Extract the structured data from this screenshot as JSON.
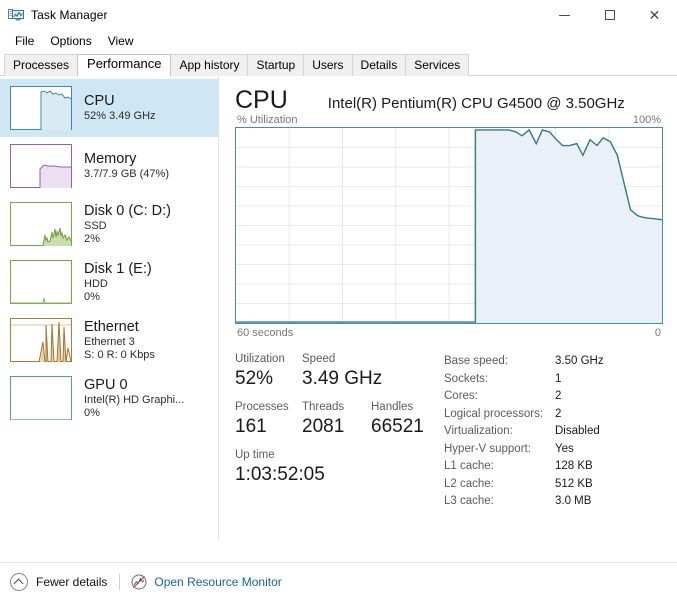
{
  "window": {
    "title": "Task Manager",
    "icon": "task-manager-icon",
    "controls": {
      "minimize": "—",
      "maximize": "□",
      "close": "✕"
    }
  },
  "menu": {
    "items": [
      {
        "label": "File"
      },
      {
        "label": "Options"
      },
      {
        "label": "View"
      }
    ]
  },
  "tabs": {
    "active": "Performance",
    "items": [
      {
        "label": "Processes"
      },
      {
        "label": "Performance"
      },
      {
        "label": "App history"
      },
      {
        "label": "Startup"
      },
      {
        "label": "Users"
      },
      {
        "label": "Details"
      },
      {
        "label": "Services"
      }
    ]
  },
  "sidebar": {
    "items": [
      {
        "name": "cpu",
        "title": "CPU",
        "sub1": "52%  3.49 GHz",
        "sub2": "",
        "selected": true,
        "color": "#3b8ba8",
        "fill": "#daeaf3"
      },
      {
        "name": "memory",
        "title": "Memory",
        "sub1": "3.7/7.9 GB (47%)",
        "sub2": "",
        "selected": false,
        "color": "#9b5fa8",
        "fill": "#ecdff0"
      },
      {
        "name": "disk-0",
        "title": "Disk 0 (C: D:)",
        "sub1": "SSD",
        "sub2": "2%",
        "selected": false,
        "color": "#7ba44a",
        "fill": "#e3eed5"
      },
      {
        "name": "disk-1",
        "title": "Disk 1 (E:)",
        "sub1": "HDD",
        "sub2": "0%",
        "selected": false,
        "color": "#7ba44a",
        "fill": "#e3eed5"
      },
      {
        "name": "ethernet",
        "title": "Ethernet",
        "sub1": "Ethernet 3",
        "sub2": "S: 0 R: 0 Kbps",
        "selected": false,
        "color": "#b07b3c",
        "fill": "#f0e2cc"
      },
      {
        "name": "gpu-0",
        "title": "GPU 0",
        "sub1": "Intel(R) HD Graphi...",
        "sub2": "0%",
        "selected": false,
        "color": "#5d95b5",
        "fill": "#dfeaf2"
      }
    ]
  },
  "main": {
    "title": "CPU",
    "model": "Intel(R) Pentium(R) CPU G4500 @ 3.50GHz",
    "graph_axis_top_left": "% Utilization",
    "graph_axis_top_right": "100%",
    "graph_axis_bottom_left": "60 seconds",
    "graph_axis_bottom_right": "0",
    "graph_line_color": "#35788c",
    "graph_fill_color": "#e9f0f7",
    "graph_border_color": "#4a8ca5"
  },
  "chart_data": {
    "type": "area",
    "title": "% Utilization",
    "xlabel": "60 seconds",
    "ylabel": "% Utilization",
    "ylim": [
      0,
      100
    ],
    "xlim": [
      60,
      0
    ],
    "grid": true,
    "legend": "none",
    "series": [
      {
        "name": "CPU Utilization",
        "values": [
          0,
          0,
          0,
          0,
          0,
          0,
          0,
          0,
          0,
          0,
          0,
          0,
          0,
          0,
          0,
          0,
          0,
          0,
          0,
          0,
          0,
          0,
          0,
          0,
          0,
          0,
          0,
          0,
          0,
          0,
          0,
          0,
          0,
          0,
          0,
          0,
          99,
          99,
          99,
          99,
          99,
          99,
          99,
          98,
          96,
          99,
          92,
          99,
          98,
          94,
          91,
          91,
          92,
          86,
          94,
          91,
          95,
          93,
          86,
          73,
          58,
          55,
          54
        ]
      }
    ]
  },
  "stats": {
    "rows": [
      [
        {
          "label": "Utilization",
          "value": "52%"
        },
        {
          "label": "Speed",
          "value": "3.49 GHz"
        }
      ],
      [
        {
          "label": "Processes",
          "value": "161"
        },
        {
          "label": "Threads",
          "value": "2081"
        },
        {
          "label": "Handles",
          "value": "66521"
        }
      ],
      [
        {
          "label": "Up time",
          "value": "1:03:52:05"
        }
      ]
    ],
    "specs": [
      {
        "label": "Base speed:",
        "value": "3.50 GHz"
      },
      {
        "label": "Sockets:",
        "value": "1"
      },
      {
        "label": "Cores:",
        "value": "2"
      },
      {
        "label": "Logical processors:",
        "value": "2"
      },
      {
        "label": "Virtualization:",
        "value": "Disabled"
      },
      {
        "label": "Hyper-V support:",
        "value": "Yes"
      },
      {
        "label": "L1 cache:",
        "value": "128 KB"
      },
      {
        "label": "L2 cache:",
        "value": "512 KB"
      },
      {
        "label": "L3 cache:",
        "value": "3.0 MB"
      }
    ]
  },
  "statusbar": {
    "fewer_details": "Fewer details",
    "open_resource_monitor": "Open Resource Monitor",
    "link_color": "#1464a5"
  }
}
